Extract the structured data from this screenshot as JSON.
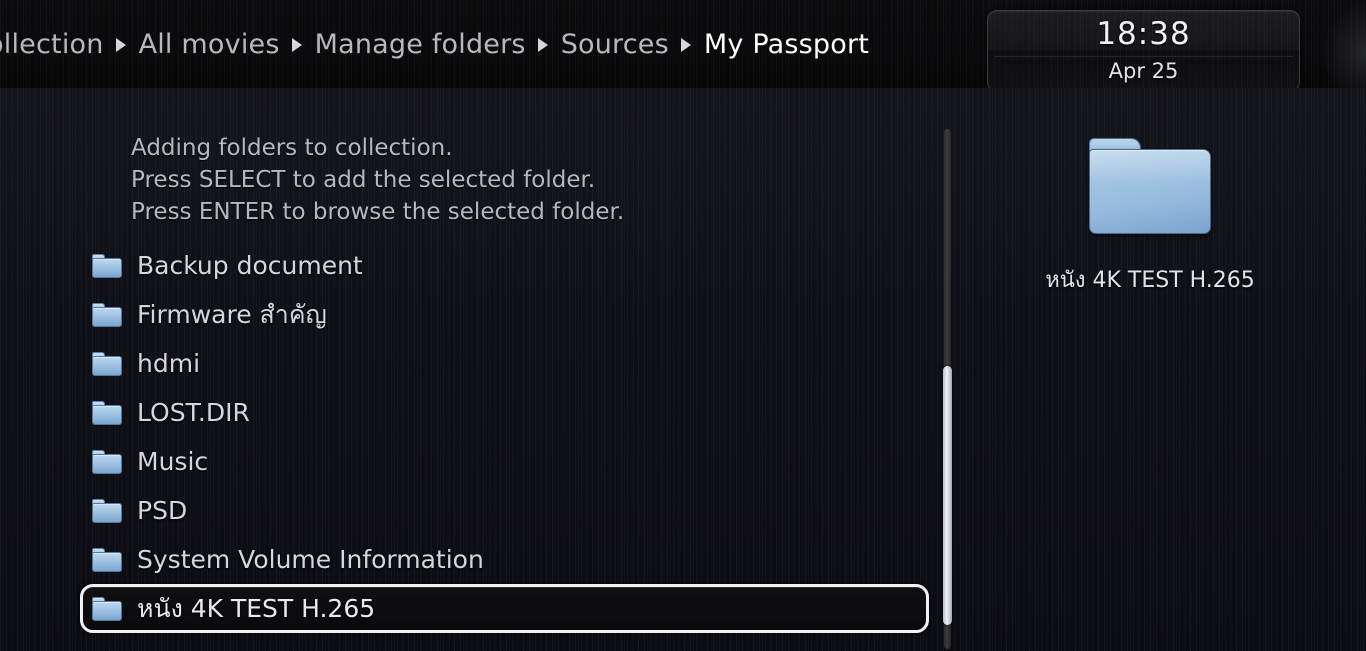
{
  "header": {
    "breadcrumb": [
      {
        "label": "Collection",
        "current": false
      },
      {
        "label": "All movies",
        "current": false
      },
      {
        "label": "Manage folders",
        "current": false
      },
      {
        "label": "Sources",
        "current": false
      },
      {
        "label": "My Passport",
        "current": true
      }
    ],
    "separator_icon": "chevron-right-icon"
  },
  "clock": {
    "time": "18:38",
    "date": "Apr 25"
  },
  "instructions": [
    "Adding folders to collection.",
    "Press SELECT to add the selected folder.",
    "Press ENTER to browse the selected folder."
  ],
  "folder_list": {
    "icon": "folder-icon",
    "items": [
      {
        "label": "Backup document",
        "selected": false
      },
      {
        "label": "Firmware สำคัญ",
        "selected": false
      },
      {
        "label": "hdmi",
        "selected": false
      },
      {
        "label": "LOST.DIR",
        "selected": false
      },
      {
        "label": "Music",
        "selected": false
      },
      {
        "label": "PSD",
        "selected": false
      },
      {
        "label": "System Volume Information",
        "selected": false
      },
      {
        "label": "หนัง 4K TEST H.265",
        "selected": true
      }
    ]
  },
  "scrollbar": {
    "orientation": "vertical",
    "thumb_top_pct": 45.6,
    "thumb_height_pct": 49.8
  },
  "preview": {
    "icon": "folder-icon-large",
    "label": "หนัง 4K TEST H.265"
  },
  "colors": {
    "background": "#0c0d12",
    "header_background": "#0a0a0c",
    "text_primary": "#d6d7da",
    "text_muted": "#b6b8bd",
    "text_highlight": "#ffffff",
    "folder_blue": "#a6c7e5",
    "selection_border": "#f2f2f2",
    "scroll_thumb": "#eef0f2"
  }
}
